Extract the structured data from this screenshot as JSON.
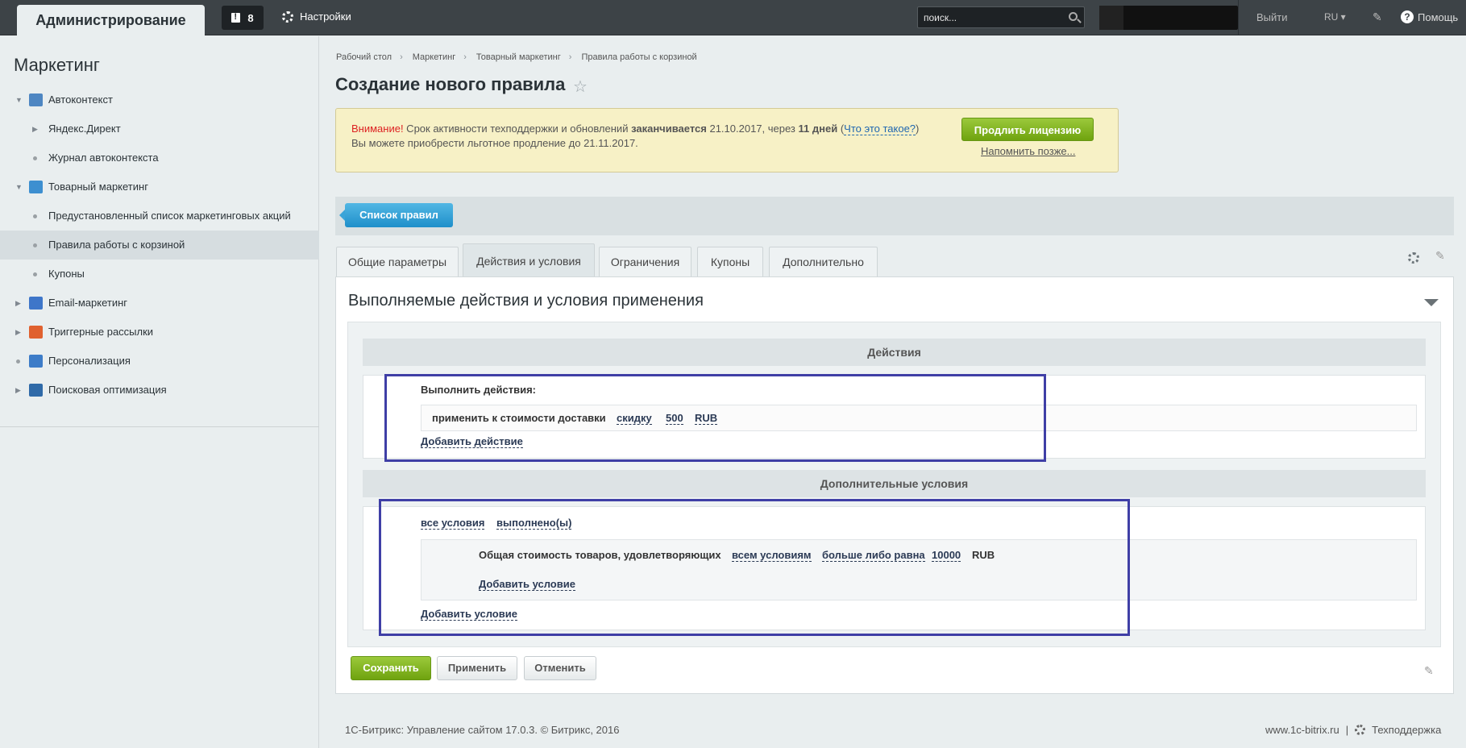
{
  "topbar": {
    "brand": "Администрирование",
    "notifications_count": "8",
    "settings_label": "Настройки",
    "search_placeholder": "поиск...",
    "logout": "Выйти",
    "lang": "RU",
    "help": "Помощь"
  },
  "sidebar": {
    "title": "Маркетинг",
    "items": [
      {
        "label": "Автоконтекст",
        "level": 0,
        "arrow": "▼",
        "icon_color": "#4e86c2"
      },
      {
        "label": "Яндекс.Директ",
        "level": 1,
        "arrow": "▶"
      },
      {
        "label": "Журнал автоконтекста",
        "level": 1,
        "dot": true
      },
      {
        "label": "Товарный маркетинг",
        "level": 0,
        "arrow": "▼",
        "icon_color": "#3d8fd0"
      },
      {
        "label": "Предустановленный список маркетинговых акций",
        "level": 1,
        "dot": true
      },
      {
        "label": "Правила работы с корзиной",
        "level": 1,
        "dot": true,
        "active": true
      },
      {
        "label": "Купоны",
        "level": 1,
        "dot": true
      },
      {
        "label": "Email-маркетинг",
        "level": 0,
        "arrow": "▶",
        "icon_color": "#3e76c9"
      },
      {
        "label": "Триггерные рассылки",
        "level": 0,
        "arrow": "▶",
        "icon_color": "#e0612f"
      },
      {
        "label": "Персонализация",
        "level": 0,
        "dot": true,
        "icon_color": "#3d7cc8"
      },
      {
        "label": "Поисковая оптимизация",
        "level": 0,
        "arrow": "▶",
        "icon_color": "#2f6aa8"
      }
    ]
  },
  "breadcrumb": [
    "Рабочий стол",
    "Маркетинг",
    "Товарный маркетинг",
    "Правила работы с корзиной"
  ],
  "page_title": "Создание нового правила",
  "alert": {
    "warn": "Внимание!",
    "text1": " Срок активности техподдержки и обновлений ",
    "bold1": "заканчивается",
    "text2": " 21.10.2017, через ",
    "bold2": "11 дней",
    "text3": " (",
    "link": "Что это такое?",
    "text4": ")",
    "line2": "Вы можете приобрести льготное продление до 21.11.2017.",
    "renew_button": "Продлить лицензию",
    "remind_link": "Напомнить позже..."
  },
  "toolbar": {
    "list_button": "Список правил"
  },
  "tabs": [
    "Общие параметры",
    "Действия и условия",
    "Ограничения",
    "Купоны",
    "Дополнительно"
  ],
  "active_tab": 1,
  "panel": {
    "title": "Выполняемые действия и условия применения",
    "actions_header": "Действия",
    "actions_title": "Выполнить действия:",
    "action_text": "применить к стоимости доставки",
    "action_type": "скидку",
    "action_value": "500",
    "action_currency": "RUB",
    "add_action": "Добавить действие",
    "conditions_header": "Дополнительные условия",
    "cond_all": "все условия",
    "cond_done": "выполнено(ы)",
    "cond_text": "Общая стоимость товаров, удовлетворяющих",
    "cond_scope": "всем условиям",
    "cond_op": "больше либо равна",
    "cond_value": "10000",
    "cond_currency": "RUB",
    "add_condition_inner": "Добавить условие",
    "add_condition": "Добавить условие"
  },
  "buttons": {
    "save": "Сохранить",
    "apply": "Применить",
    "cancel": "Отменить"
  },
  "footer": {
    "copyright": "1С-Битрикс: Управление сайтом 17.0.3. © Битрикс, 2016",
    "site": "www.1c-bitrix.ru",
    "divider": "|",
    "support": "Техподдержка"
  }
}
